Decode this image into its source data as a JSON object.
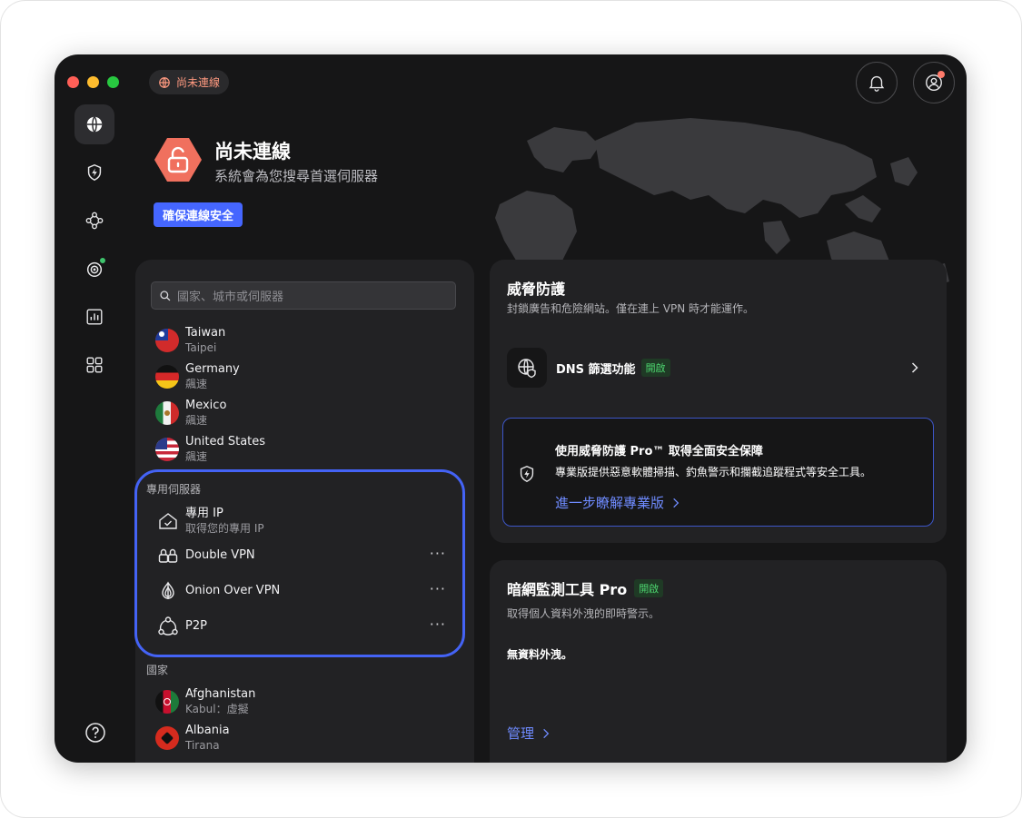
{
  "status": {
    "pill_label": "尚未連線",
    "title": "尚未連線",
    "subtitle": "系統會為您搜尋首選伺服器",
    "secure_button": "確保連線安全"
  },
  "sidebar": {
    "items": [
      {
        "icon": "globe-icon",
        "active": true
      },
      {
        "icon": "shield-bolt-icon",
        "active": false
      },
      {
        "icon": "meshnet-icon",
        "active": false
      },
      {
        "icon": "radar-icon",
        "active": false
      },
      {
        "icon": "chart-icon",
        "active": false
      },
      {
        "icon": "apps-grid-icon",
        "active": false
      }
    ],
    "help_icon": "help-icon"
  },
  "search": {
    "placeholder": "國家、城市或伺服器"
  },
  "recent_countries": [
    {
      "name": "Taiwan",
      "sub": "Taipei"
    },
    {
      "name": "Germany",
      "sub": "飆速"
    },
    {
      "name": "Mexico",
      "sub": "飆速"
    },
    {
      "name": "United States",
      "sub": "飆速"
    }
  ],
  "special": {
    "section_label": "專用伺服器",
    "items": [
      {
        "name": "專用 IP",
        "sub": "取得您的專用 IP"
      },
      {
        "name": "Double VPN",
        "more": "···"
      },
      {
        "name": "Onion Over VPN",
        "more": "···"
      },
      {
        "name": "P2P",
        "more": "···"
      }
    ]
  },
  "countries": {
    "section_label": "國家",
    "items": [
      {
        "name": "Afghanistan",
        "sub": "Kabul：虛擬"
      },
      {
        "name": "Albania",
        "sub": "Tirana"
      }
    ]
  },
  "threat": {
    "title": "威脅防護",
    "subtitle": "封鎖廣告和危險網站。僅在連上 VPN 時才能運作。",
    "dns_label": "DNS 篩選功能",
    "dns_badge": "開啟",
    "pro_title": "使用威脅防護 Pro™ 取得全面安全保障",
    "pro_desc": "專業版提供惡意軟體掃描、釣魚警示和攔截追蹤程式等安全工具。",
    "pro_link": "進一步瞭解專業版"
  },
  "darkweb": {
    "title": "暗網監測工具 Pro",
    "badge": "開啟",
    "subtitle": "取得個人資料外洩的即時警示。",
    "status": "無資料外洩。",
    "manage_link": "管理"
  },
  "colors": {
    "accent": "#4566ff",
    "danger": "#f0705e",
    "success": "#4cd36e"
  }
}
